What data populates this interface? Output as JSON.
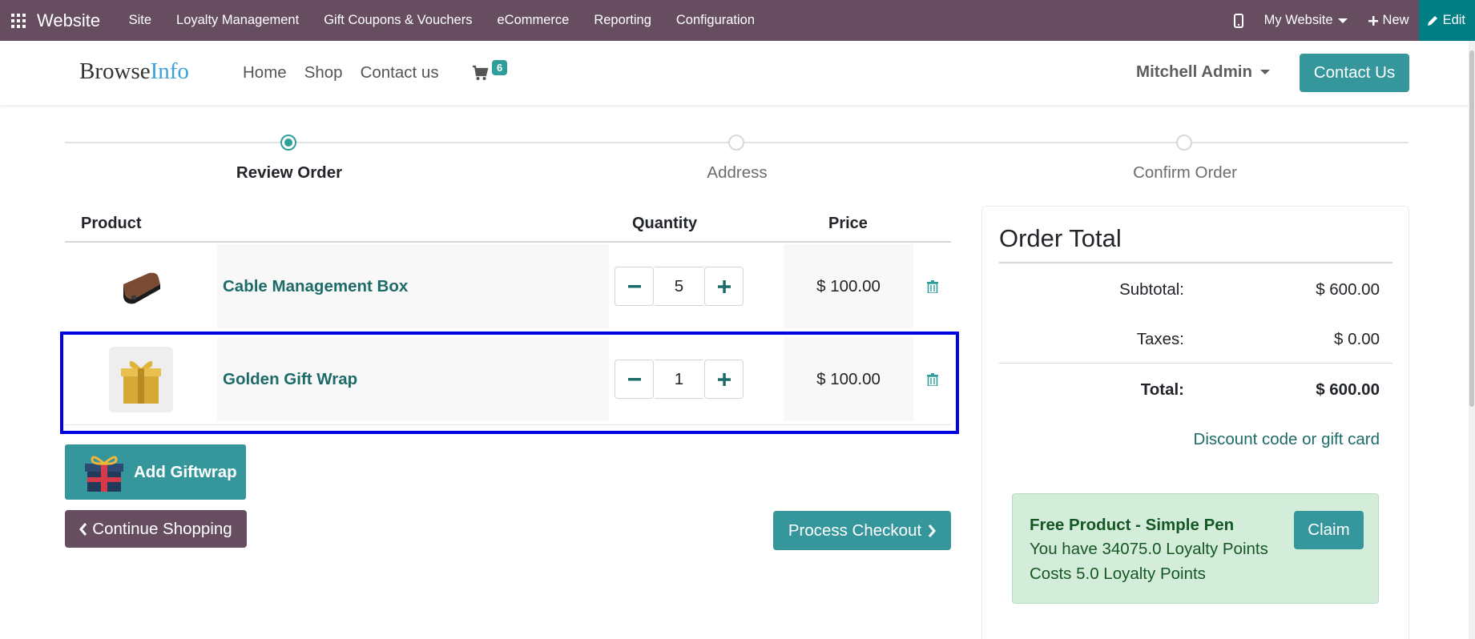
{
  "topbar": {
    "brand": "Website",
    "menu": [
      "Site",
      "Loyalty Management",
      "Gift Coupons & Vouchers",
      "eCommerce",
      "Reporting",
      "Configuration"
    ],
    "my_website": "My Website",
    "new_label": "New",
    "edit_label": "Edit",
    "color": "#664d60",
    "edit_color": "#017e84"
  },
  "header": {
    "logo_part1": "Browse",
    "logo_part2": "Info",
    "nav": [
      "Home",
      "Shop",
      "Contact us"
    ],
    "cart_count": "6",
    "user": "Mitchell Admin",
    "contact_button": "Contact Us",
    "accent": "#35979c"
  },
  "steps": [
    "Review Order",
    "Address",
    "Confirm Order"
  ],
  "active_step": "Review Order",
  "cart": {
    "headers": {
      "product": "Product",
      "quantity": "Quantity",
      "price": "Price"
    },
    "rows": [
      {
        "name": "Cable Management Box",
        "qty": "5",
        "price": "$ 100.00",
        "image_icon": "cable-box-image"
      },
      {
        "name": "Golden Gift Wrap",
        "qty": "1",
        "price": "$ 100.00",
        "image_icon": "gift-box-image"
      }
    ],
    "add_giftwrap": "Add Giftwrap",
    "continue_shopping": "Continue Shopping",
    "process_checkout": "Process Checkout"
  },
  "totals": {
    "title": "Order Total",
    "subtotal_label": "Subtotal:",
    "subtotal": "$ 600.00",
    "taxes_label": "Taxes:",
    "taxes": "$ 0.00",
    "total_label": "Total:",
    "total": "$ 600.00",
    "discount_link": "Discount code or gift card"
  },
  "promo": {
    "title": "Free Product - Simple Pen",
    "line1": "You have 34075.0 Loyalty Points",
    "line2": "Costs 5.0 Loyalty Points",
    "claim": "Claim"
  }
}
